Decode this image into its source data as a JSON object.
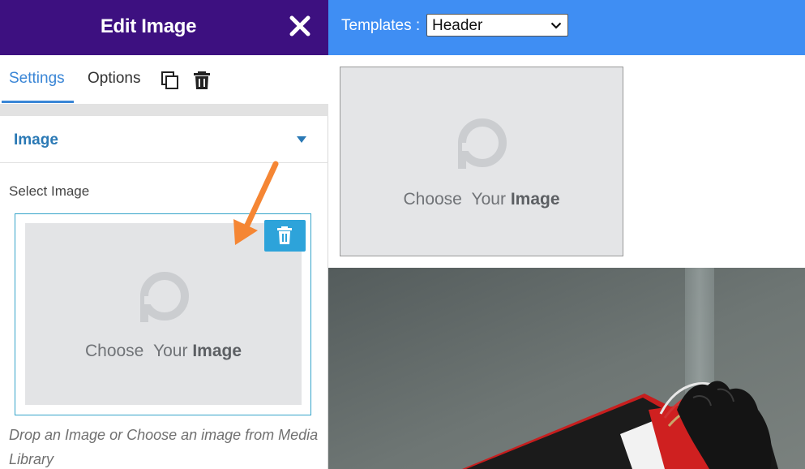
{
  "panel": {
    "title": "Edit Image",
    "tabs": {
      "settings": "Settings",
      "options": "Options"
    },
    "section": {
      "title": "Image"
    },
    "select_label": "Select Image",
    "picker": {
      "choose": "Choose",
      "your": "Your",
      "image": "Image"
    },
    "help_text": "Drop an Image or Choose an image from Media Library"
  },
  "topbar": {
    "templates_label": "Templates :",
    "templates_value": "Header"
  },
  "canvas": {
    "placeholder": {
      "choose": "Choose",
      "your": "Your",
      "image": "Image"
    }
  },
  "icons": {
    "close": "close-icon",
    "copy": "copy-icon",
    "trash": "trash-icon",
    "caret": "caret-down-icon",
    "logo": "p-logo-icon",
    "arrow": "arrow-annotation"
  },
  "colors": {
    "header_purple": "#3d1080",
    "topbar_blue": "#3f8ef3",
    "accent_blue": "#3a86d6",
    "delete_button": "#2da3da",
    "annotation_orange": "#f58634"
  }
}
